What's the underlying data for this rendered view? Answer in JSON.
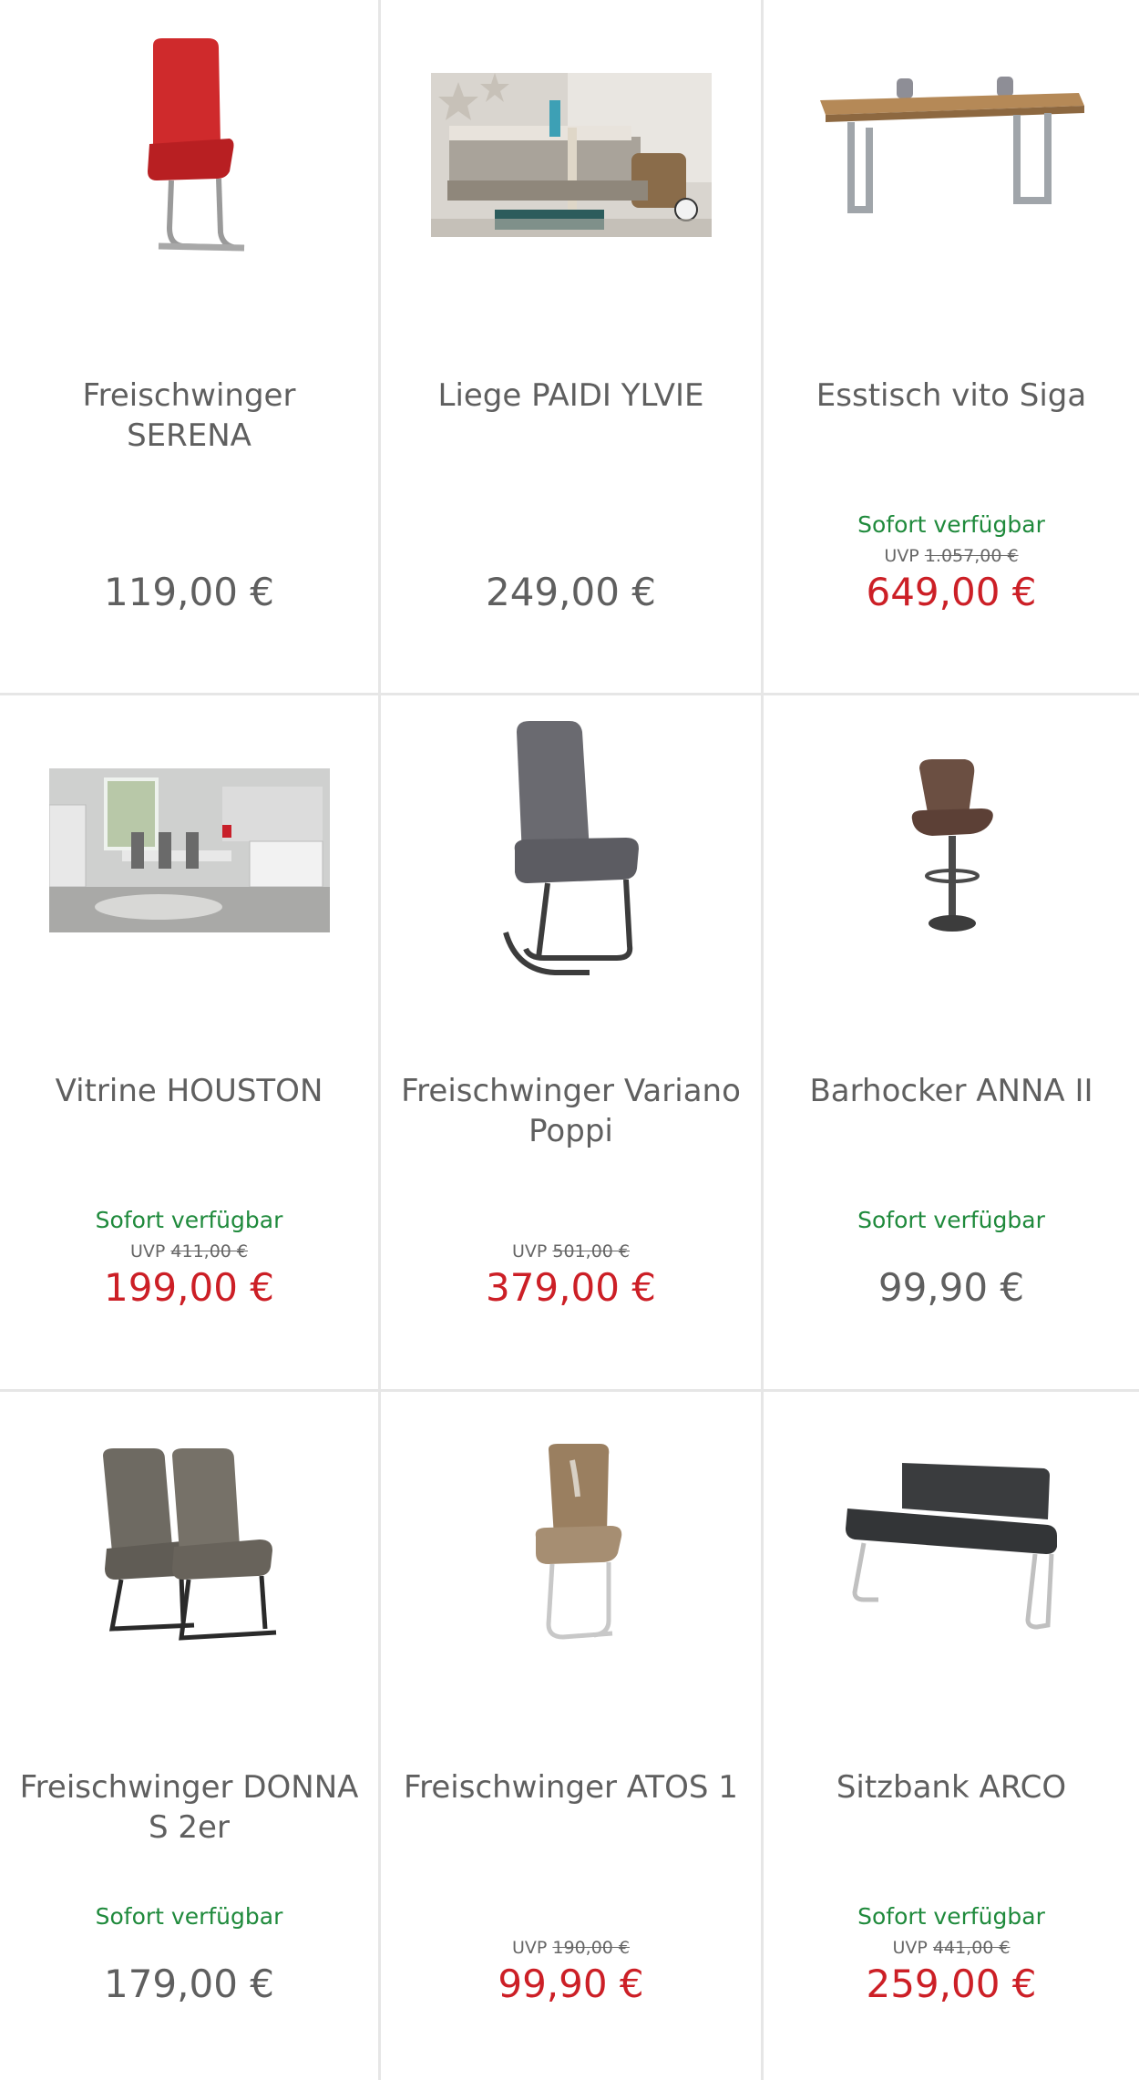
{
  "products": [
    {
      "name": "Freischwinger SERENA",
      "availability": "",
      "uvp_label": "",
      "uvp_price": "",
      "price": "119,00 €",
      "sale": false,
      "image_icon": "red-cantilever-chair-image"
    },
    {
      "name": "Liege PAIDI YLVIE",
      "availability": "",
      "uvp_label": "",
      "uvp_price": "",
      "price": "249,00 €",
      "sale": false,
      "image_icon": "kids-bed-image"
    },
    {
      "name": "Esstisch vito Siga",
      "availability": "Sofort verfügbar",
      "uvp_label": "UVP",
      "uvp_price": "1.057,00 €",
      "price": "649,00 €",
      "sale": true,
      "image_icon": "dining-table-image"
    },
    {
      "name": "Vitrine HOUSTON",
      "availability": "Sofort verfügbar",
      "uvp_label": "UVP",
      "uvp_price": "411,00 €",
      "price": "199,00 €",
      "sale": true,
      "image_icon": "dining-room-image"
    },
    {
      "name": "Freischwinger Variano Poppi",
      "availability": "",
      "uvp_label": "UVP",
      "uvp_price": "501,00 €",
      "price": "379,00 €",
      "sale": true,
      "image_icon": "grey-cantilever-chair-image"
    },
    {
      "name": "Barhocker ANNA II",
      "availability": "Sofort verfügbar",
      "uvp_label": "",
      "uvp_price": "",
      "price": "99,90 €",
      "sale": false,
      "image_icon": "bar-stool-image"
    },
    {
      "name": "Freischwinger DONNA S 2er",
      "availability": "Sofort verfügbar",
      "uvp_label": "",
      "uvp_price": "",
      "price": "179,00 €",
      "sale": false,
      "image_icon": "two-chairs-image"
    },
    {
      "name": "Freischwinger ATOS 1",
      "availability": "",
      "uvp_label": "UVP",
      "uvp_price": "190,00 €",
      "price": "99,90 €",
      "sale": true,
      "image_icon": "beige-chair-image"
    },
    {
      "name": "Sitzbank ARCO",
      "availability": "Sofort verfügbar",
      "uvp_label": "UVP",
      "uvp_price": "441,00 €",
      "price": "259,00 €",
      "sale": true,
      "image_icon": "bench-image"
    }
  ],
  "colors": {
    "sale_price": "#cc1f26",
    "regular_price": "#5f5f5f",
    "availability": "#1f8a3c",
    "grid_line": "#e6e6e6"
  }
}
